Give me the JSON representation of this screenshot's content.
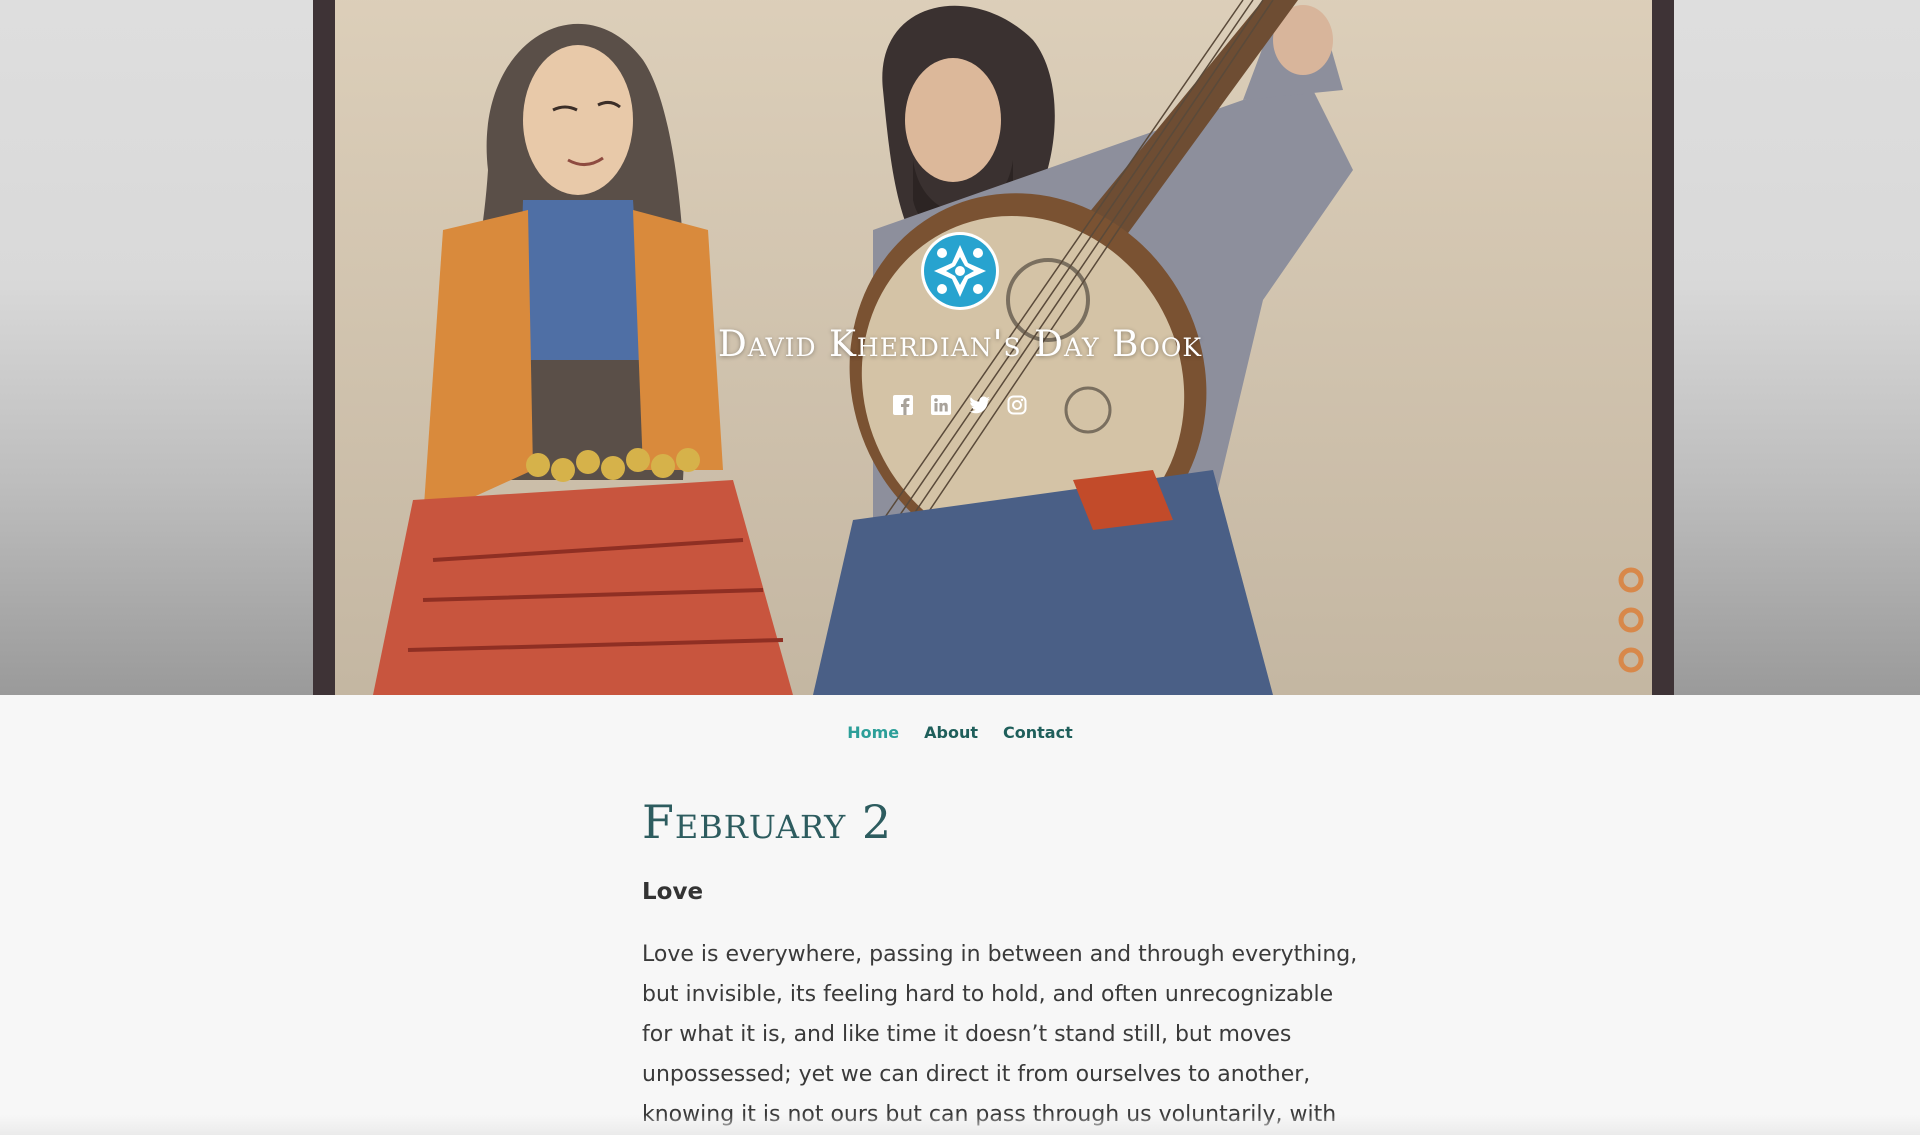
{
  "site": {
    "title": "David Kherdian's Day Book",
    "logo_icon": "geometric-star-logo-icon",
    "logo_color": "#27a3cf"
  },
  "social": [
    {
      "name": "facebook-icon"
    },
    {
      "name": "linkedin-icon"
    },
    {
      "name": "twitter-icon"
    },
    {
      "name": "instagram-icon"
    }
  ],
  "nav": {
    "items": [
      {
        "label": "Home",
        "active": true
      },
      {
        "label": "About",
        "active": false
      },
      {
        "label": "Contact",
        "active": false
      }
    ]
  },
  "post": {
    "title": "February 2",
    "subtitle": "Love",
    "body": "Love is everywhere, passing in between and through everything, but invisible, its feeling hard to hold, and often unrecognizable for what it is, and like time it doesn’t stand still, but moves unpossessed; yet we can direct it from ourselves to another, knowing it is not ours but can pass through us voluntarily, with"
  },
  "colors": {
    "nav_link": "#1f5f5b",
    "nav_active": "#2c9f99",
    "title": "#2d5c5f",
    "text": "#3a3a3a"
  }
}
